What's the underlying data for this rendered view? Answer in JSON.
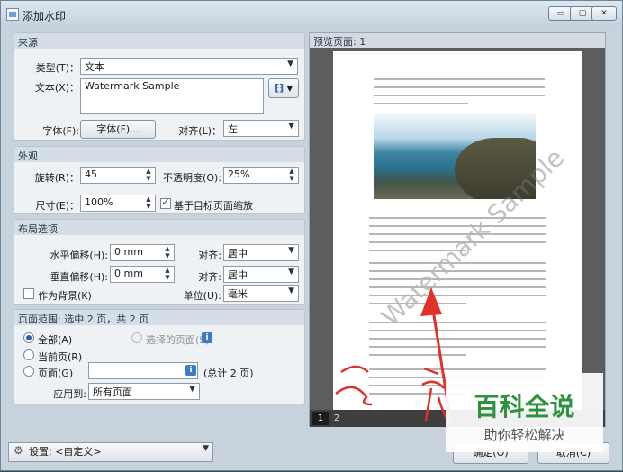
{
  "window": {
    "title": "添加水印",
    "caption_buttons": [
      "▭",
      "▢",
      "✕"
    ]
  },
  "source": {
    "header": "来源",
    "type_label": "类型(T)：",
    "type_value": "文本",
    "text_label": "文本(X)：",
    "text_value": "Watermark Sample",
    "insert_field_icon": "field-icon",
    "font_label": "字体(F):",
    "font_button": "字体(F)...",
    "align_label": "对齐(L)：",
    "align_value": "左"
  },
  "appearance": {
    "header": "外观",
    "rotation_label": "旋转(R)：",
    "rotation_value": "45",
    "opacity_label": "不透明度(O):",
    "opacity_value": "25%",
    "size_label": "尺寸(E)：",
    "size_value": "100%",
    "scale_checkbox_label": "基于目标页面缩放",
    "scale_checked": true
  },
  "layout": {
    "header": "布局选项",
    "h_offset_label": "水平偏移(H):",
    "h_offset_value": "0 mm",
    "h_align_label": "对齐:",
    "h_align_value": "居中",
    "v_offset_label": "垂直偏移(H):",
    "v_offset_value": "0 mm",
    "v_align_label": "对齐:",
    "v_align_value": "居中",
    "background_label": "作为背景(K)",
    "background_checked": false,
    "unit_label": "单位(U):",
    "unit_value": "毫米"
  },
  "page_range": {
    "header": "页面范围: 选中 2 页，共 2 页",
    "all_label": "全部(A)",
    "selected_label": "选择的页面(S)",
    "current_label": "当前页(R)",
    "pages_label": "页面(G)",
    "pages_value": "",
    "total_label": "(总计 2 页)",
    "apply_label": "应用到:",
    "apply_value": "所有页面",
    "selected_option": "all"
  },
  "preview": {
    "title": "预览页面: 1",
    "watermark_text": "Watermark Sample",
    "page_tabs": [
      "1",
      "2"
    ],
    "active_page": "1"
  },
  "bottom": {
    "settings_label": "设置: <自定义>",
    "ok_label": "确定(O)",
    "cancel_label": "取消(C)"
  },
  "overlay": {
    "brand_main": "百科全说",
    "brand_sub": "助你轻松解决",
    "annotation_color": "#e0302a"
  }
}
